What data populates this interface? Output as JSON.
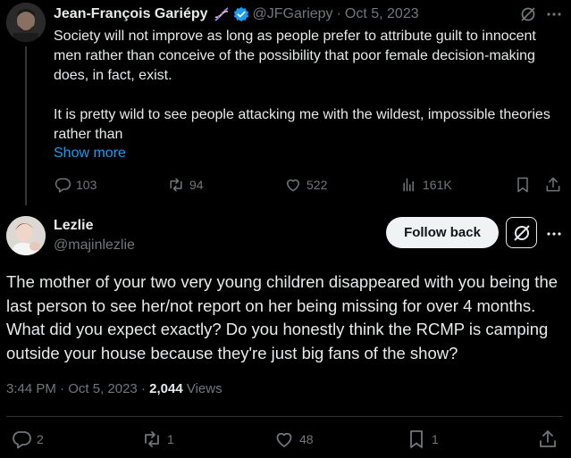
{
  "parent_tweet": {
    "author_name": "Jean-François Gariépy",
    "badge_emoji": "dna-icon",
    "verified": true,
    "handle": "@JFGariepy",
    "separator": "·",
    "date": "Oct 5, 2023",
    "text_paragraph_1": "Society will not improve as long as people prefer to attribute guilt to innocent men rather than conceive of the possibility that poor female decision-making does, in fact, exist.",
    "text_paragraph_2": "It is pretty wild to see people attacking me with the wildest, impossible theories rather than",
    "show_more": "Show more",
    "replies": "103",
    "reposts": "94",
    "likes": "522",
    "views": "161K"
  },
  "main_tweet": {
    "author_name": "Lezlie",
    "handle": "@majinlezlie",
    "follow_button": "Follow back",
    "text": "The mother of your two very young children disappeared with you being the last person to see her/not report on her being missing for over 4 months. What did you expect exactly? Do you honestly think the RCMP is camping outside your house because they're just big fans of the show?",
    "time": "3:44 PM",
    "separator": "·",
    "date": "Oct 5, 2023",
    "separator2": "·",
    "views_count": "2,044",
    "views_label": "Views",
    "replies": "2",
    "reposts": "1",
    "likes": "48",
    "bookmarks": "1"
  },
  "colors": {
    "background": "#000000",
    "text_primary": "#e7e9ea",
    "text_secondary": "#71767b",
    "link": "#1d9bf0",
    "verified": "#1d9bf0",
    "divider": "#2f3336"
  }
}
